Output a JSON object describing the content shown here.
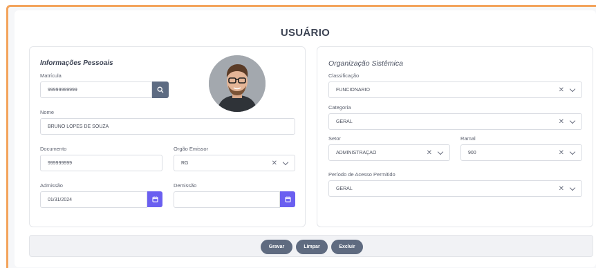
{
  "page": {
    "title": "USUÁRIO"
  },
  "personal": {
    "section_title": "Informações Pessoais",
    "matricula": {
      "label": "Matrícula",
      "value": "99999999999"
    },
    "nome": {
      "label": "Nome",
      "value": "BRUNO LOPES DE SOUZA"
    },
    "documento": {
      "label": "Documento",
      "value": "999999999"
    },
    "orgao_emissor": {
      "label": "Orgão Emissor",
      "value": "RG"
    },
    "admissao": {
      "label": "Admissão",
      "value": "01/31/2024"
    },
    "demissao": {
      "label": "Demissão",
      "value": ""
    }
  },
  "organization": {
    "section_title": "Organização Sistêmica",
    "classificacao": {
      "label": "Classificação",
      "value": "FUNCIONÁRIO"
    },
    "categoria": {
      "label": "Categoria",
      "value": "GERAL"
    },
    "setor": {
      "label": "Setor",
      "value": "ADMINISTRAÇÃO"
    },
    "ramal": {
      "label": "Ramal",
      "value": "900"
    },
    "periodo": {
      "label": "Período de Acesso Permitido",
      "value": "GERAL"
    }
  },
  "actions": {
    "save": "Gravar",
    "clear": "Limpar",
    "delete": "Excluir"
  },
  "icons": {
    "search": "search-icon",
    "calendar": "calendar-icon",
    "clear": "clear-x-icon",
    "dropdown": "chevron-down-icon"
  },
  "colors": {
    "accent_border": "#f3a35b",
    "search_button": "#5d6b82",
    "calendar_button": "#6a5ff0",
    "action_button": "#5f6b80"
  }
}
